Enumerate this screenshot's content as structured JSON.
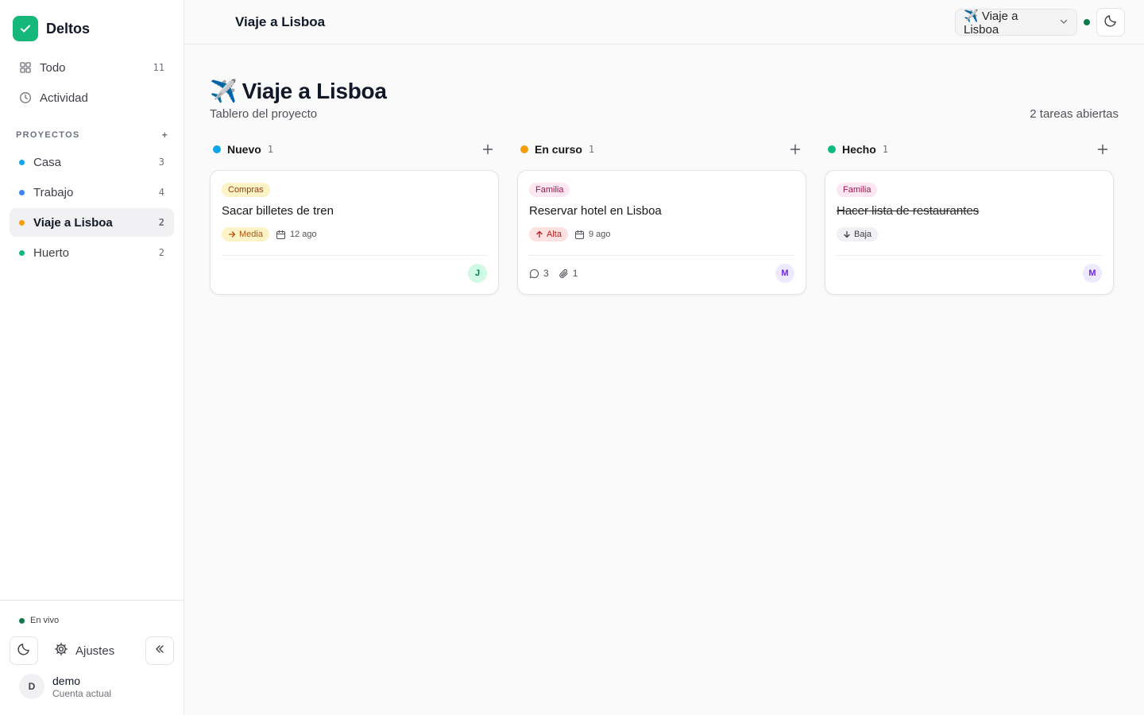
{
  "app": {
    "name": "Deltos"
  },
  "sidebar": {
    "nav": [
      {
        "label": "Todo",
        "count": "11",
        "icon": "grid-icon"
      },
      {
        "label": "Actividad",
        "icon": "clock-icon"
      }
    ],
    "projects_header": "PROYECTOS",
    "projects_add": "+",
    "projects": [
      {
        "label": "Casa",
        "count": "3",
        "color": "#0ea5e9"
      },
      {
        "label": "Trabajo",
        "count": "4",
        "color": "#3b82f6"
      },
      {
        "label": "Viaje a Lisboa",
        "count": "2",
        "color": "#f59e0b",
        "active": true
      },
      {
        "label": "Huerto",
        "count": "2",
        "color": "#10b981"
      }
    ],
    "live_label": "En vivo",
    "settings_label": "Ajustes",
    "user": {
      "initial": "D",
      "name": "demo",
      "subtitle": "Cuenta actual"
    }
  },
  "topbar": {
    "title": "Viaje a Lisboa",
    "switcher_label": "✈️ Viaje a Lisboa"
  },
  "page": {
    "emoji": "✈️",
    "title": "Viaje a Lisboa",
    "subtitle": "Tablero del proyecto",
    "open_tasks": "2 tareas abiertas"
  },
  "columns": [
    {
      "name": "Nuevo",
      "count": "1",
      "color": "#0ea5e9",
      "card": {
        "tag": "Compras",
        "tag_bg": "#fef3c7",
        "tag_fg": "#92400e",
        "title": "Sacar billetes de tren",
        "done": false,
        "priority": "Media",
        "priority_bg": "#fef3c7",
        "priority_fg": "#b45309",
        "priority_icon": "arrow-right-icon",
        "date": "12 ago",
        "comments": null,
        "attachments": null,
        "assignee": "J",
        "assignee_bg": "#d1fae5",
        "assignee_fg": "#047857"
      }
    },
    {
      "name": "En curso",
      "count": "1",
      "color": "#f59e0b",
      "card": {
        "tag": "Familia",
        "tag_bg": "#fce7f3",
        "tag_fg": "#9d174d",
        "title": "Reservar hotel en Lisboa",
        "done": false,
        "priority": "Alta",
        "priority_bg": "#fee2e2",
        "priority_fg": "#b91c1c",
        "priority_icon": "arrow-up-icon",
        "date": "9 ago",
        "comments": "3",
        "attachments": "1",
        "assignee": "M",
        "assignee_bg": "#ede9fe",
        "assignee_fg": "#6d28d9"
      }
    },
    {
      "name": "Hecho",
      "count": "1",
      "color": "#10b981",
      "card": {
        "tag": "Familia",
        "tag_bg": "#fce7f3",
        "tag_fg": "#9d174d",
        "title": "Hacer lista de restaurantes",
        "done": true,
        "priority": "Baja",
        "priority_bg": "#f1f1f3",
        "priority_fg": "#3f3f46",
        "priority_icon": "arrow-down-icon",
        "date": null,
        "comments": null,
        "attachments": null,
        "assignee": "M",
        "assignee_bg": "#ede9fe",
        "assignee_fg": "#6d28d9"
      }
    }
  ]
}
